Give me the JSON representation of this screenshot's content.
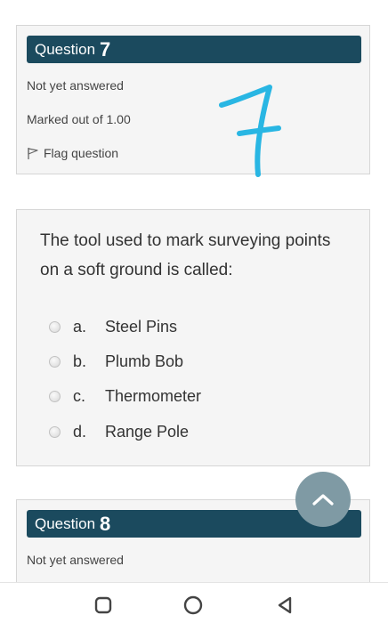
{
  "question7": {
    "word": "Question",
    "number": "7",
    "state": "Not yet answered",
    "marks": "Marked out of 1.00",
    "flag_label": "Flag question"
  },
  "handwritten_note": "7",
  "question": {
    "text": "The tool used to mark surveying points on a soft ground is called:",
    "options": [
      {
        "letter": "a.",
        "text": "Steel Pins"
      },
      {
        "letter": "b.",
        "text": "Plumb Bob"
      },
      {
        "letter": "c.",
        "text": "Thermometer"
      },
      {
        "letter": "d.",
        "text": "Range Pole"
      }
    ]
  },
  "question8": {
    "word": "Question",
    "number": "8",
    "state": "Not yet answered"
  },
  "icons": {
    "flag": "flag-icon",
    "scroll_top": "chevron-up-icon",
    "nav_recents": "square-icon",
    "nav_home": "circle-icon",
    "nav_back": "triangle-back-icon"
  },
  "colors": {
    "header_bg": "#1b4a5e",
    "handwriting": "#29b6e3",
    "scroll_button": "#7f9aa4"
  }
}
